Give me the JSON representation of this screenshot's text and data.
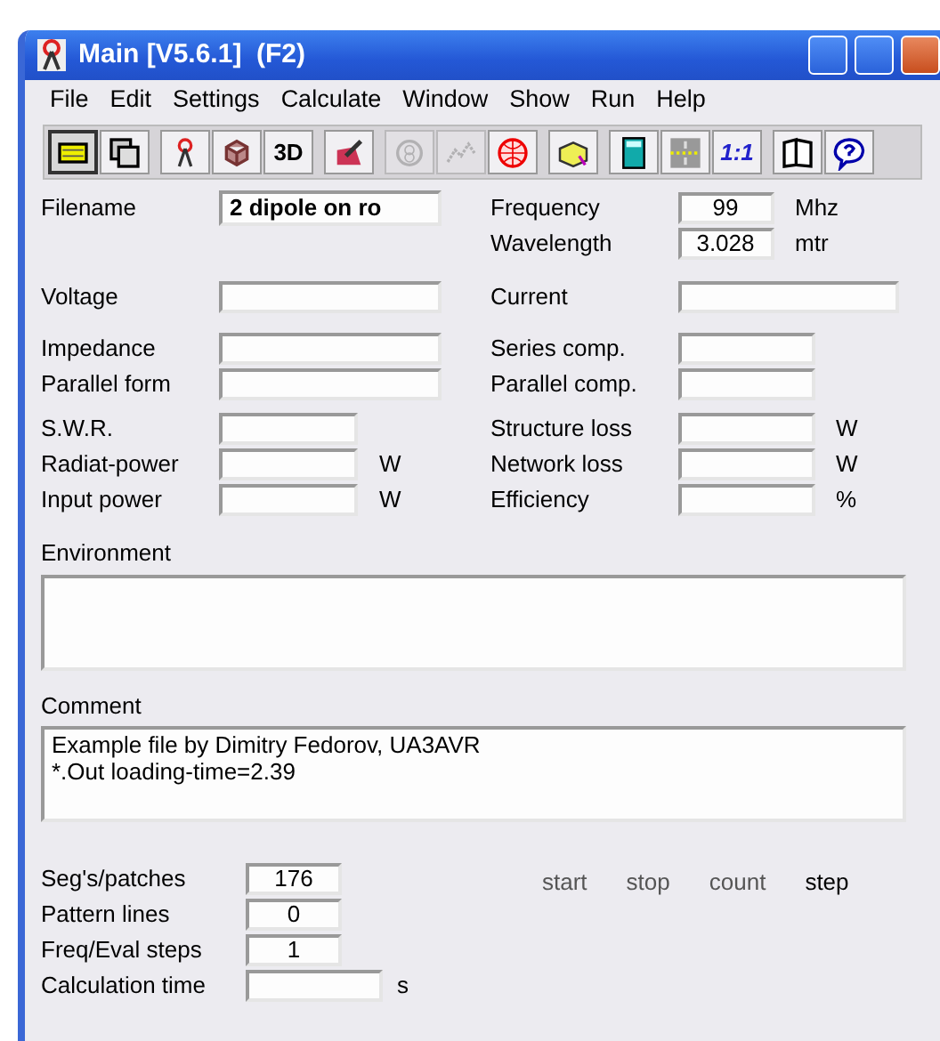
{
  "window": {
    "title": "Main [V5.6.1]  (F2)"
  },
  "menu": [
    "File",
    "Edit",
    "Settings",
    "Calculate",
    "Window",
    "Show",
    "Run",
    "Help"
  ],
  "toolbar": [
    [
      {
        "kind": "icon",
        "pressed": true,
        "disabled": false
      },
      {
        "kind": "icon",
        "pressed": false,
        "disabled": false
      }
    ],
    [
      {
        "kind": "icon",
        "pressed": false,
        "disabled": false
      },
      {
        "kind": "icon",
        "pressed": false,
        "disabled": false
      },
      {
        "kind": "text",
        "label": "3D",
        "pressed": false,
        "disabled": false
      }
    ],
    [
      {
        "kind": "icon",
        "pressed": false,
        "disabled": false
      }
    ],
    [
      {
        "kind": "icon",
        "pressed": false,
        "disabled": true
      },
      {
        "kind": "icon",
        "pressed": false,
        "disabled": true
      },
      {
        "kind": "icon",
        "pressed": false,
        "disabled": false
      }
    ],
    [
      {
        "kind": "icon",
        "pressed": false,
        "disabled": false
      }
    ],
    [
      {
        "kind": "icon",
        "pressed": false,
        "disabled": false
      },
      {
        "kind": "icon",
        "pressed": false,
        "disabled": false
      },
      {
        "kind": "text",
        "label": "1:1",
        "pressed": false,
        "disabled": false
      }
    ],
    [
      {
        "kind": "icon",
        "pressed": false,
        "disabled": false
      },
      {
        "kind": "icon",
        "pressed": false,
        "disabled": false
      }
    ]
  ],
  "sections": [
    [
      {
        "left": {
          "label": "Filename",
          "value": "2 dipole on ro"
        },
        "right": {
          "label": "Frequency",
          "value": "99",
          "unit": "Mhz"
        }
      },
      {
        "right": {
          "label": "Wavelength",
          "value": "3.028",
          "unit": "mtr"
        }
      }
    ],
    [
      {
        "left": {
          "label": "Voltage"
        },
        "right": {
          "label": "Current"
        }
      }
    ],
    [
      {
        "left": {
          "label": "Impedance"
        },
        "right": {
          "label": "Series comp."
        }
      },
      {
        "left": {
          "label": "Parallel form"
        },
        "right": {
          "label": "Parallel comp."
        }
      }
    ],
    [
      {
        "left": {
          "label": "S.W.R."
        },
        "right": {
          "label": "Structure loss",
          "unit": "W"
        }
      },
      {
        "left": {
          "label": "Radiat-power",
          "unit": "W"
        },
        "right": {
          "label": "Network loss",
          "unit": "W"
        }
      },
      {
        "left": {
          "label": "Input power",
          "unit": "W"
        },
        "right": {
          "label": "Efficiency",
          "unit": "%"
        }
      }
    ]
  ],
  "environment": {
    "label": "Environment"
  },
  "comment": {
    "label": "Comment",
    "lines": [
      "Example file by Dimitry Fedorov, UA3AVR",
      "*.Out loading-time=2.39"
    ]
  },
  "run_settings": [
    {
      "label": "Seg's/patches",
      "value": "176"
    },
    {
      "label": "Pattern lines",
      "value": "0"
    },
    {
      "label": "Freq/Eval steps",
      "value": "1"
    },
    {
      "label": "Calculation time",
      "unit": "s"
    }
  ],
  "step_columns": [
    {
      "label": "start",
      "active": false
    },
    {
      "label": "stop",
      "active": false
    },
    {
      "label": "count",
      "active": false
    },
    {
      "label": "step",
      "active": true
    }
  ]
}
